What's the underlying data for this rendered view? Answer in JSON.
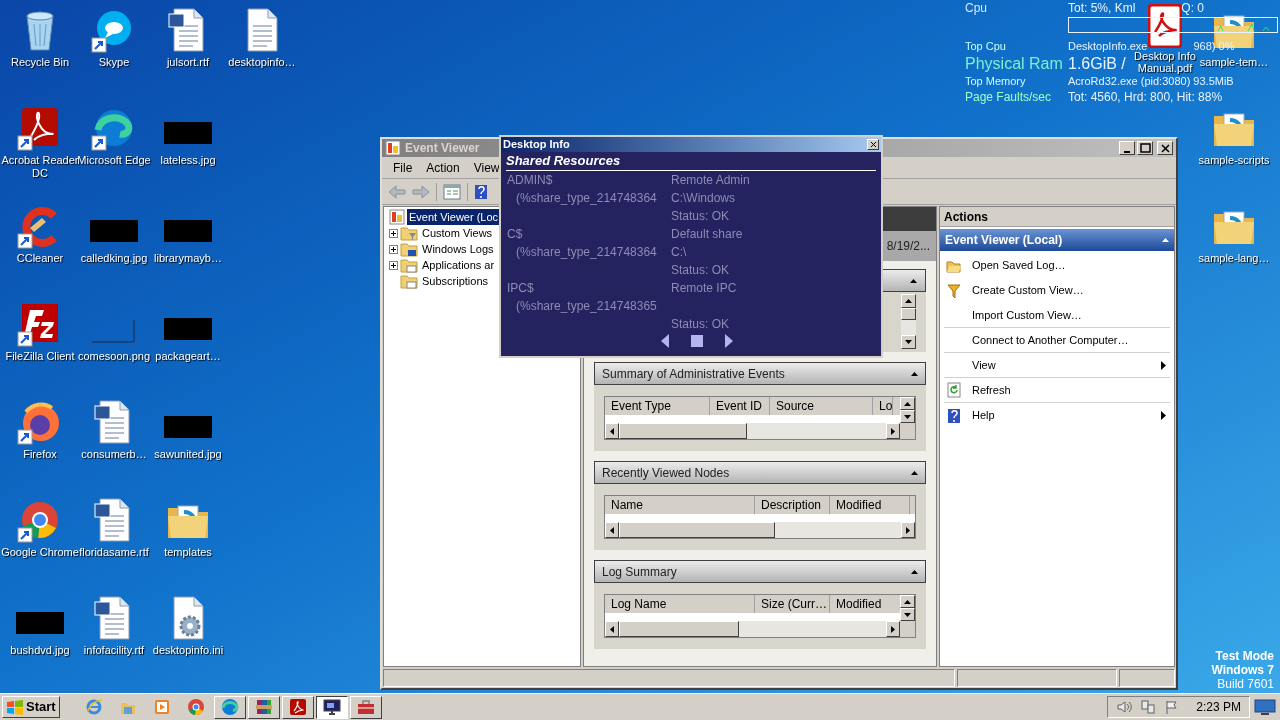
{
  "desktop_icons": [
    {
      "label": "Recycle Bin",
      "kind": "recycle",
      "shortcut": false
    },
    {
      "label": "Acrobat Reader DC",
      "kind": "acrobat",
      "shortcut": true
    },
    {
      "label": "CCleaner",
      "kind": "ccleaner",
      "shortcut": true
    },
    {
      "label": "FileZilla Client",
      "kind": "filezilla",
      "shortcut": true
    },
    {
      "label": "Firefox",
      "kind": "firefox",
      "shortcut": true
    },
    {
      "label": "Google Chrome",
      "kind": "chrome",
      "shortcut": true
    },
    {
      "label": "bushdvd.jpg",
      "kind": "image",
      "shortcut": false
    },
    {
      "label": "Skype",
      "kind": "skype",
      "shortcut": true
    },
    {
      "label": "Microsoft Edge",
      "kind": "edge",
      "shortcut": true
    },
    {
      "label": "calledking.jpg",
      "kind": "image",
      "shortcut": false
    },
    {
      "label": "comesoon.png",
      "kind": "blank-image",
      "shortcut": false
    },
    {
      "label": "consumerb…",
      "kind": "word",
      "shortcut": false
    },
    {
      "label": "floridasame.rtf",
      "kind": "word",
      "shortcut": false
    },
    {
      "label": "infofacility.rtf",
      "kind": "word",
      "shortcut": false
    },
    {
      "label": "julsort.rtf",
      "kind": "word",
      "shortcut": false
    },
    {
      "label": "lateless.jpg",
      "kind": "image",
      "shortcut": false
    },
    {
      "label": "librarymayb…",
      "kind": "image",
      "shortcut": false
    },
    {
      "label": "packageart…",
      "kind": "image",
      "shortcut": false
    },
    {
      "label": "sawunited.jpg",
      "kind": "image",
      "shortcut": false
    },
    {
      "label": "templates",
      "kind": "folder",
      "shortcut": false
    },
    {
      "label": "desktopinfo.ini",
      "kind": "ini",
      "shortcut": false
    },
    {
      "label": "desktopinfo…",
      "kind": "text",
      "shortcut": false
    }
  ],
  "right_desktop_icons": [
    {
      "label": "sample-tem…",
      "kind": "folder",
      "shortcut": false
    },
    {
      "label": "sample-scripts",
      "kind": "folder",
      "shortcut": false
    },
    {
      "label": "sample-lang…",
      "kind": "folder",
      "shortcut": false
    }
  ],
  "pdf_icon": {
    "label": "Desktop Info Manual.pdf",
    "kind": "pdf",
    "shortcut": false
  },
  "system_overlay": {
    "rows": [
      {
        "label": "Cpu",
        "values": [
          "Tot:  5%, Kml",
          "Q: 0"
        ],
        "kind": "medium",
        "color": "#d8e8ff",
        "graph": true
      },
      {
        "label": "Top Cpu",
        "values": [
          "DesktopInfo.exe",
          "968) 0%"
        ],
        "kind": "small",
        "color": "#c8ffff"
      },
      {
        "label": "Physical Ram",
        "values": [
          "1.6GiB /"
        ],
        "kind": "large",
        "color": "#7ff0d0"
      },
      {
        "label": "Top Memory",
        "values": [
          "AcroRd32.exe (pid:3080) 93.5MiB"
        ],
        "kind": "small",
        "color": "#c8ffff"
      },
      {
        "label": "Page Faults/sec",
        "values": [
          "Tot: 4560, Hrd: 800, Hit: 88%"
        ],
        "kind": "medium",
        "color": "#a0ffc8"
      }
    ]
  },
  "event_viewer": {
    "title": "Event Viewer",
    "menu": [
      "File",
      "Action",
      "View"
    ],
    "toolbar": [
      {
        "kind": "back"
      },
      {
        "kind": "forward"
      },
      {
        "kind": "pane"
      },
      {
        "kind": "help"
      }
    ],
    "tree": [
      {
        "label": "Event Viewer (Loc",
        "kind": "root",
        "expandable": false,
        "selected": true
      },
      {
        "label": "Custom Views",
        "kind": "filter-folder",
        "expandable": true,
        "selected": false
      },
      {
        "label": "Windows Logs",
        "kind": "log-folder",
        "expandable": true,
        "selected": false
      },
      {
        "label": "Applications ar",
        "kind": "folder",
        "expandable": true,
        "selected": false
      },
      {
        "label": "Subscriptions",
        "kind": "folder",
        "expandable": false,
        "selected": false
      }
    ],
    "center": {
      "date_fragment": "8/19/2...",
      "sections": [
        {
          "kind": "list"
        },
        {
          "kind": "table",
          "title": "Summary of Administrative Events",
          "columns": [
            "Event Type",
            "Event ID",
            "Source",
            "Lo"
          ],
          "vertical_scroll": true
        },
        {
          "kind": "table",
          "title": "Recently Viewed Nodes",
          "columns": [
            "Name",
            "Description",
            "Modified"
          ],
          "vertical_scroll": false
        },
        {
          "kind": "table",
          "title": "Log Summary",
          "columns": [
            "Log Name",
            "Size (Curr…",
            "Modified"
          ],
          "vertical_scroll": true
        }
      ]
    },
    "actions": {
      "title": "Actions",
      "group": "Event Viewer (Local)",
      "items": [
        {
          "label": "Open Saved Log…",
          "kind": "open",
          "submenu": false,
          "separator_after": false
        },
        {
          "label": "Create Custom View…",
          "kind": "filter",
          "submenu": false,
          "separator_after": false
        },
        {
          "label": "Import Custom View…",
          "kind": "plain",
          "submenu": false,
          "separator_after": true
        },
        {
          "label": "Connect to Another Computer…",
          "kind": "plain",
          "submenu": false,
          "separator_after": true
        },
        {
          "label": "View",
          "kind": "plain",
          "submenu": true,
          "separator_after": true
        },
        {
          "label": "Refresh",
          "kind": "refresh",
          "submenu": false,
          "separator_after": true
        },
        {
          "label": "Help",
          "kind": "help",
          "submenu": true,
          "separator_after": false
        }
      ]
    }
  },
  "desktop_info_window": {
    "title": "Desktop Info",
    "heading": "Shared Resources",
    "shares": [
      {
        "name": "ADMIN$",
        "type": "(%share_type_214748364",
        "description": "Remote Admin",
        "path": "C:\\Windows",
        "status": "Status: OK"
      },
      {
        "name": "C$",
        "type": "(%share_type_214748364",
        "description": "Default share",
        "path": "C:\\",
        "status": "Status: OK"
      },
      {
        "name": "IPC$",
        "type": "(%share_type_214748365",
        "description": "Remote IPC",
        "status": "Status: OK"
      }
    ]
  },
  "os_watermark": [
    "Test Mode",
    "Windows 7",
    "Build 7601"
  ],
  "taskbar": {
    "start": "Start",
    "items": [
      {
        "kind": "ie",
        "running": false,
        "selected": false
      },
      {
        "kind": "explorer",
        "running": false,
        "selected": false
      },
      {
        "kind": "media",
        "running": false,
        "selected": false
      },
      {
        "kind": "chrome",
        "running": false,
        "selected": false
      },
      {
        "kind": "edge",
        "running": true,
        "selected": false
      },
      {
        "kind": "archive",
        "running": true,
        "selected": false
      },
      {
        "kind": "acrobat",
        "running": true,
        "selected": false
      },
      {
        "kind": "monitor",
        "running": true,
        "selected": true
      },
      {
        "kind": "toolbox",
        "running": true,
        "selected": false
      }
    ],
    "time": "2:23 PM"
  }
}
